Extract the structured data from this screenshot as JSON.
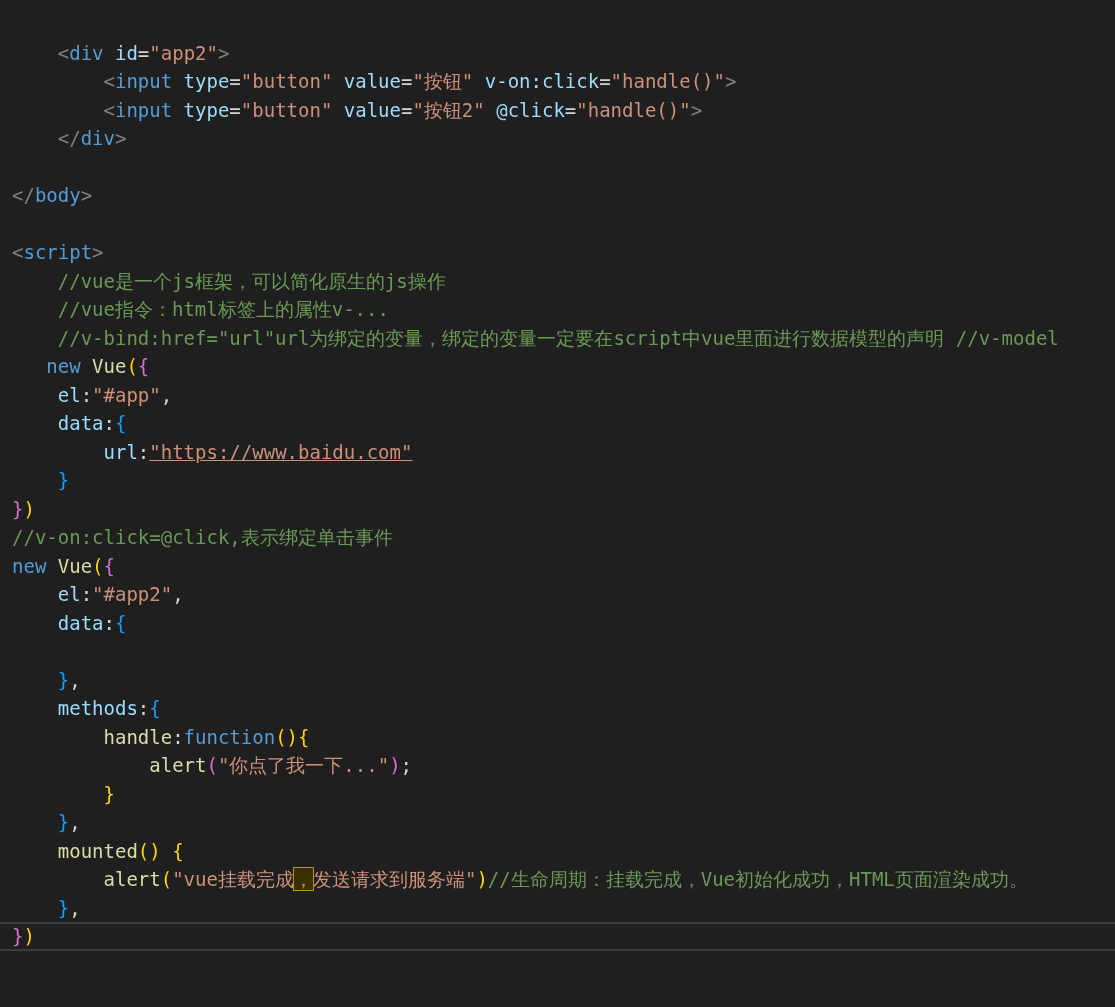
{
  "editor": {
    "lines": [
      {
        "current": false
      },
      {
        "current": false,
        "tokens": [
          {
            "kind": "tag",
            "text": "    <"
          },
          {
            "kind": "tagname",
            "text": "div "
          },
          {
            "kind": "attr",
            "text": "id"
          },
          {
            "kind": "plain",
            "text": "="
          },
          {
            "kind": "string",
            "text": "\"app2\""
          },
          {
            "kind": "tag",
            "text": ">"
          }
        ]
      },
      {
        "current": false,
        "tokens": [
          {
            "kind": "tag",
            "text": "        <"
          },
          {
            "kind": "tagname",
            "text": "input "
          },
          {
            "kind": "attr",
            "text": "type"
          },
          {
            "kind": "plain",
            "text": "="
          },
          {
            "kind": "string",
            "text": "\"button\" "
          },
          {
            "kind": "attr",
            "text": "value"
          },
          {
            "kind": "plain",
            "text": "="
          },
          {
            "kind": "string",
            "text": "\"按钮\" "
          },
          {
            "kind": "attr",
            "text": "v-on:click"
          },
          {
            "kind": "plain",
            "text": "="
          },
          {
            "kind": "string",
            "text": "\"handle()\""
          },
          {
            "kind": "tag",
            "text": ">"
          }
        ]
      },
      {
        "current": false,
        "tokens": [
          {
            "kind": "tag",
            "text": "        <"
          },
          {
            "kind": "tagname",
            "text": "input "
          },
          {
            "kind": "attr",
            "text": "type"
          },
          {
            "kind": "plain",
            "text": "="
          },
          {
            "kind": "string",
            "text": "\"button\" "
          },
          {
            "kind": "attr",
            "text": "value"
          },
          {
            "kind": "plain",
            "text": "="
          },
          {
            "kind": "string",
            "text": "\"按钮2\" "
          },
          {
            "kind": "attr",
            "text": "@click"
          },
          {
            "kind": "plain",
            "text": "="
          },
          {
            "kind": "string",
            "text": "\"handle()\""
          },
          {
            "kind": "tag",
            "text": ">"
          }
        ]
      },
      {
        "current": false,
        "tokens": [
          {
            "kind": "tag",
            "text": "    </"
          },
          {
            "kind": "tagname",
            "text": "div"
          },
          {
            "kind": "tag",
            "text": ">"
          }
        ]
      },
      {
        "current": false
      },
      {
        "current": false,
        "tokens": [
          {
            "kind": "tag",
            "text": "</"
          },
          {
            "kind": "tagname",
            "text": "body"
          },
          {
            "kind": "tag",
            "text": ">"
          }
        ]
      },
      {
        "current": false
      },
      {
        "current": false,
        "tokens": [
          {
            "kind": "tag",
            "text": "<"
          },
          {
            "kind": "tagname",
            "text": "script"
          },
          {
            "kind": "tag",
            "text": ">"
          }
        ]
      },
      {
        "current": false,
        "tokens": [
          {
            "kind": "comment",
            "text": "    //vue是一个js框架，可以简化原生的js操作"
          }
        ]
      },
      {
        "current": false,
        "tokens": [
          {
            "kind": "comment",
            "text": "    //vue指令：html标签上的属性v-..."
          }
        ]
      },
      {
        "current": false,
        "tokens": [
          {
            "kind": "comment",
            "text": "    //v-bind:href=\"url\"url为绑定的变量，绑定的变量一定要在script中vue里面进行数据模型的声明 //v-model"
          }
        ]
      },
      {
        "current": false,
        "tokens": [
          {
            "kind": "keyword",
            "text": "   new "
          },
          {
            "kind": "func",
            "text": "Vue"
          },
          {
            "kind": "bracket1",
            "text": "("
          },
          {
            "kind": "bracket2",
            "text": "{"
          }
        ]
      },
      {
        "current": false,
        "tokens": [
          {
            "kind": "prop",
            "text": "    el"
          },
          {
            "kind": "plain",
            "text": ":"
          },
          {
            "kind": "string",
            "text": "\"#app\""
          },
          {
            "kind": "plain",
            "text": ","
          }
        ]
      },
      {
        "current": false,
        "tokens": [
          {
            "kind": "prop",
            "text": "    data"
          },
          {
            "kind": "plain",
            "text": ":"
          },
          {
            "kind": "bracket3",
            "text": "{"
          }
        ]
      },
      {
        "current": false,
        "tokens": [
          {
            "kind": "prop",
            "text": "        url"
          },
          {
            "kind": "plain",
            "text": ":"
          },
          {
            "kind": "link",
            "text": "\"https://www.baidu.com\""
          }
        ]
      },
      {
        "current": false,
        "tokens": [
          {
            "kind": "bracket3",
            "text": "    }"
          }
        ]
      },
      {
        "current": false,
        "tokens": [
          {
            "kind": "bracket2",
            "text": "}"
          },
          {
            "kind": "bracket1",
            "text": ")"
          }
        ]
      },
      {
        "current": false,
        "tokens": [
          {
            "kind": "comment",
            "text": "//v-on:click=@click,表示绑定单击事件"
          }
        ]
      },
      {
        "current": false,
        "tokens": [
          {
            "kind": "keyword",
            "text": "new "
          },
          {
            "kind": "func",
            "text": "Vue"
          },
          {
            "kind": "bracket1",
            "text": "("
          },
          {
            "kind": "bracket2",
            "text": "{"
          }
        ]
      },
      {
        "current": false,
        "tokens": [
          {
            "kind": "prop",
            "text": "    el"
          },
          {
            "kind": "plain",
            "text": ":"
          },
          {
            "kind": "string",
            "text": "\"#app2\""
          },
          {
            "kind": "plain",
            "text": ","
          }
        ]
      },
      {
        "current": false,
        "tokens": [
          {
            "kind": "prop",
            "text": "    data"
          },
          {
            "kind": "plain",
            "text": ":"
          },
          {
            "kind": "bracket3",
            "text": "{"
          }
        ]
      },
      {
        "current": false
      },
      {
        "current": false,
        "tokens": [
          {
            "kind": "bracket3",
            "text": "    }"
          },
          {
            "kind": "plain",
            "text": ","
          }
        ]
      },
      {
        "current": false,
        "tokens": [
          {
            "kind": "prop",
            "text": "    methods"
          },
          {
            "kind": "plain",
            "text": ":"
          },
          {
            "kind": "bracket3",
            "text": "{"
          }
        ]
      },
      {
        "current": false,
        "tokens": [
          {
            "kind": "func",
            "text": "        handle"
          },
          {
            "kind": "plain",
            "text": ":"
          },
          {
            "kind": "keyword",
            "text": "function"
          },
          {
            "kind": "bracket1",
            "text": "(){"
          }
        ]
      },
      {
        "current": false,
        "tokens": [
          {
            "kind": "func",
            "text": "            alert"
          },
          {
            "kind": "bracket2",
            "text": "("
          },
          {
            "kind": "string",
            "text": "\"你点了我一下...\""
          },
          {
            "kind": "bracket2",
            "text": ")"
          },
          {
            "kind": "plain",
            "text": ";"
          }
        ]
      },
      {
        "current": false,
        "tokens": [
          {
            "kind": "bracket1",
            "text": "        }"
          }
        ]
      },
      {
        "current": false,
        "tokens": [
          {
            "kind": "bracket3",
            "text": "    }"
          },
          {
            "kind": "plain",
            "text": ","
          }
        ]
      },
      {
        "current": false,
        "tokens": [
          {
            "kind": "func",
            "text": "    mounted"
          },
          {
            "kind": "bracket1",
            "text": "() {"
          }
        ]
      },
      {
        "current": false,
        "tokens": [
          {
            "kind": "func",
            "text": "        alert"
          },
          {
            "kind": "bracket1",
            "text": "("
          },
          {
            "kind": "string",
            "text": "\"vue挂载完成"
          },
          {
            "kind": "match",
            "text": "，"
          },
          {
            "kind": "string",
            "text": "发送请求到服务端\""
          },
          {
            "kind": "bracket1",
            "text": ")"
          },
          {
            "kind": "comment",
            "text": "//生命周期：挂载完成，Vue初始化成功，HTML页面渲染成功。"
          }
        ]
      },
      {
        "current": false,
        "tokens": [
          {
            "kind": "bracket3",
            "text": "    }"
          },
          {
            "kind": "plain",
            "text": ","
          }
        ]
      },
      {
        "current": true,
        "tokens": [
          {
            "kind": "bracket2",
            "text": "}"
          },
          {
            "kind": "bracket1",
            "text": ")"
          }
        ]
      }
    ]
  }
}
